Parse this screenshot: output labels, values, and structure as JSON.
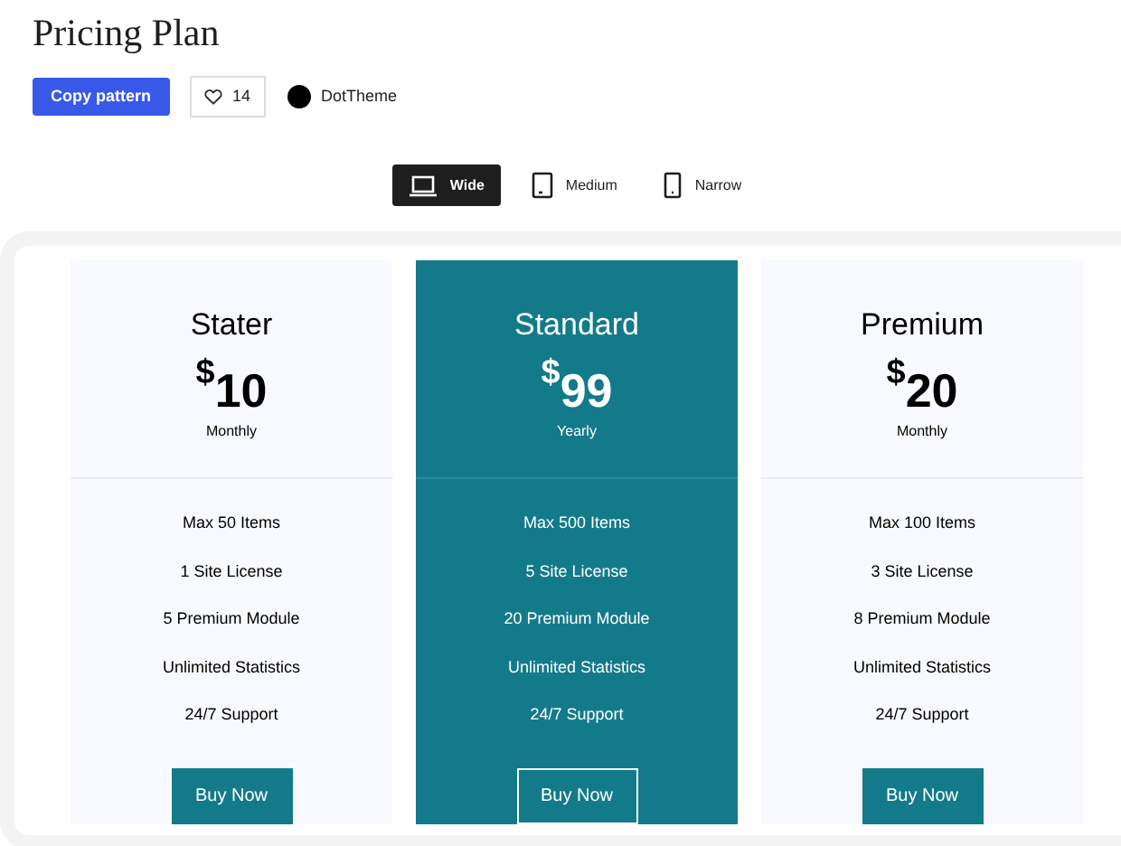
{
  "title": "Pricing Plan",
  "actions": {
    "copy": "Copy pattern",
    "likes": "14",
    "author": "DotTheme"
  },
  "views": [
    {
      "label": "Wide",
      "kind": "laptop",
      "selected": true
    },
    {
      "label": "Medium",
      "kind": "tablet",
      "selected": false
    },
    {
      "label": "Narrow",
      "kind": "phone",
      "selected": false
    }
  ],
  "plans": [
    {
      "name": "Stater",
      "currency": "$",
      "price": "10",
      "period": "Monthly",
      "featured": false,
      "features": [
        "Max 50 Items",
        "1 Site License",
        "5 Premium Module",
        "Unlimited Statistics",
        "24/7 Support"
      ],
      "button": "Buy Now"
    },
    {
      "name": "Standard",
      "currency": "$",
      "price": "99",
      "period": "Yearly",
      "featured": true,
      "features": [
        "Max 500 Items",
        "5 Site License",
        "20 Premium Module",
        "Unlimited Statistics",
        "24/7 Support"
      ],
      "button": "Buy Now"
    },
    {
      "name": "Premium",
      "currency": "$",
      "price": "20",
      "period": "Monthly",
      "featured": false,
      "features": [
        "Max 100 Items",
        "3 Site License",
        "8 Premium Module",
        "Unlimited Statistics",
        "24/7 Support"
      ],
      "button": "Buy Now"
    }
  ]
}
